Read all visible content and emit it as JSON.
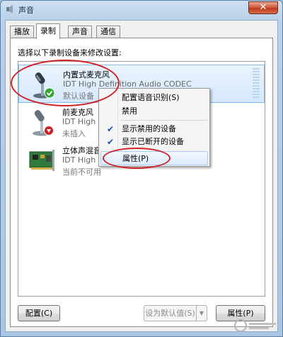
{
  "window": {
    "title": "声音",
    "close_glyph": "✕"
  },
  "tabs": [
    {
      "label": "播放",
      "active": false
    },
    {
      "label": "录制",
      "active": true
    },
    {
      "label": "声音",
      "active": false
    },
    {
      "label": "通信",
      "active": false
    }
  ],
  "instruction": "选择以下录制设备来修改设置:",
  "devices": [
    {
      "name": "内置式麦克风",
      "driver": "IDT High Definition Audio CODEC",
      "status": "默认设备",
      "icon": "microphone-icon",
      "badge": "default-check",
      "selected": true
    },
    {
      "name": "前麦克风",
      "driver": "IDT High Def",
      "status": "未插入",
      "icon": "microphone-icon",
      "badge": "unplugged",
      "selected": false
    },
    {
      "name": "立体声混音",
      "driver": "IDT High Def",
      "status": "当前不可用",
      "icon": "sound-card-icon",
      "badge": "none",
      "selected": false
    }
  ],
  "context_menu": {
    "items": [
      {
        "label": "配置语音识别(S)",
        "checked": false
      },
      {
        "label": "禁用",
        "checked": false
      },
      {
        "label": "显示禁用的设备",
        "checked": true
      },
      {
        "label": "显示已断开的设备",
        "checked": true
      },
      {
        "label": "属性(P)",
        "checked": false,
        "hover": true
      }
    ],
    "check_glyph": "✔"
  },
  "buttons": {
    "configure": "配置(C)",
    "set_default": "设为默认值(S)",
    "properties": "属性(P)",
    "dropdown_glyph": "▼"
  },
  "colors": {
    "annotation": "#d0232a",
    "selection": "#d5e8fb",
    "accent": "#1b4fb0"
  }
}
